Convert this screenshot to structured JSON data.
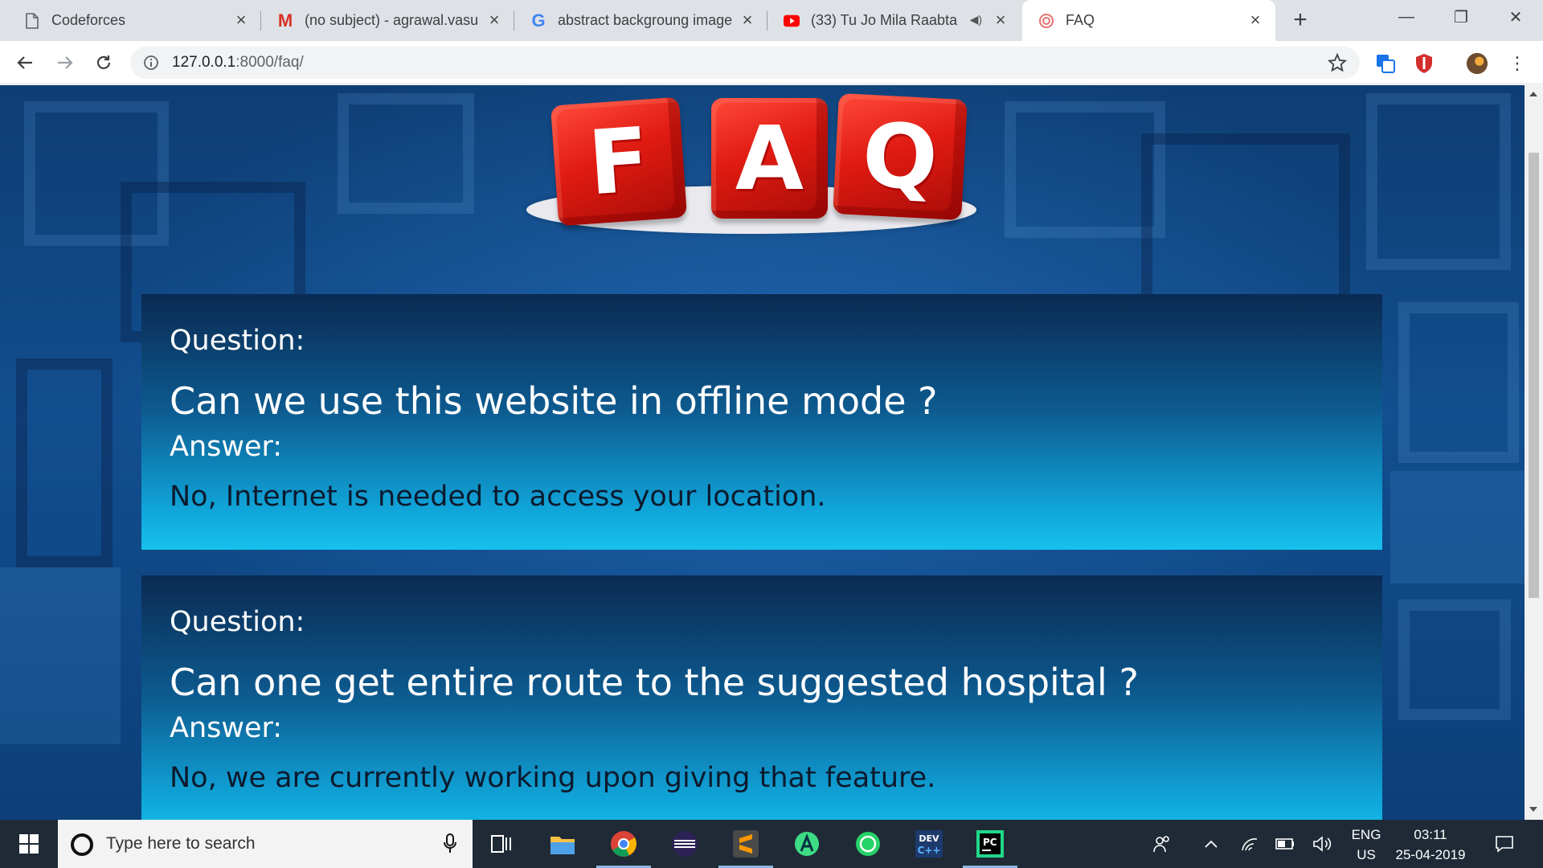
{
  "browser": {
    "tabs": [
      {
        "title": "Codeforces",
        "icon": "page-icon"
      },
      {
        "title": "(no subject) - agrawal.vasu",
        "icon": "gmail-icon"
      },
      {
        "title": "abstract backgroung image",
        "icon": "google-icon"
      },
      {
        "title": "(33) Tu Jo Mila Raabta",
        "icon": "youtube-icon"
      },
      {
        "title": "FAQ",
        "icon": "site-icon",
        "active": true
      }
    ],
    "url_host": "127.0.0.1",
    "url_path": ":8000/faq/"
  },
  "page": {
    "logo_letters": [
      "F",
      "A",
      "Q"
    ],
    "faqs": [
      {
        "question_label": "Question:",
        "question": "Can we use this website in offline mode ?",
        "answer_label": "Answer:",
        "answer": "No, Internet is needed to access your location."
      },
      {
        "question_label": "Question:",
        "question": "Can one get entire route to the suggested hospital ?",
        "answer_label": "Answer:",
        "answer": "No, we are currently working upon giving that feature."
      }
    ]
  },
  "taskbar": {
    "search_placeholder": "Type here to search",
    "lang_top": "ENG",
    "lang_bottom": "US",
    "time": "03:11",
    "date": "25-04-2019"
  },
  "colors": {
    "card_top": "#0a2a52",
    "card_bottom": "#16c2ec",
    "logo_red": "#e01b12"
  }
}
